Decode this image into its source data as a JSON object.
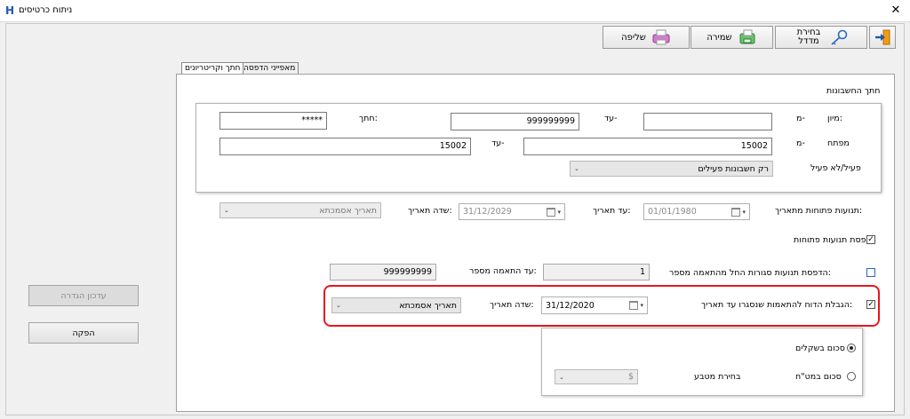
{
  "window": {
    "title": "ניתוח כרטיסים",
    "close": "✕",
    "app_icon": "H"
  },
  "toolbar": {
    "exit_icon": "exit-door-icon",
    "choose_index_label": "בחירת מדדל",
    "save_label": "שמירה",
    "send_label": "שליפה"
  },
  "tabs": [
    {
      "label": "חתך וקריטריונים"
    },
    {
      "label": "מאפייני הדפסה"
    }
  ],
  "account_section": {
    "title": "חתך החשבונות",
    "sort": {
      "label": "מיון:",
      "from_label": "מ-",
      "from_value": "",
      "to_label": "עד-",
      "to_value": "999999999",
      "cut_label": "חתך:",
      "cut_value": "*****"
    },
    "key": {
      "label": "מפתח",
      "from_label": "מ-",
      "from_value": "15002",
      "to_label": "עד-",
      "to_value": "15002"
    },
    "active": {
      "label": "פעיל/לא פעיל",
      "value": "רק חשבונות פעילים"
    }
  },
  "open_movements": {
    "label": "תנועות פתוחות מתאריך:",
    "from_date": "01/01/1980",
    "to_label": "עד תאריך:",
    "to_date": "31/12/2029",
    "date_field_label": "שדה תאריך:",
    "date_field_value": "תאריך אסמכתא"
  },
  "print_open_movements": {
    "label": "הדפסת תנועות פתוחות",
    "checked": "✓"
  },
  "closed_matches": {
    "label": "הדפסת תנועות סגורות החל מהתאמה מספר:",
    "from_value": "1",
    "to_label": "עד התאמה מספר:",
    "to_value": "999999999"
  },
  "limit_report": {
    "label": "הגבלת הדוח להתאמות שנסגרו עד תאריך:",
    "checked": "✓",
    "date": "31/12/2020",
    "date_field_label": "שדה תאריך:",
    "date_field_value": "תאריך אסמכתא"
  },
  "summary": {
    "shekels_label": "סכום בשקלים",
    "foreign_label": "סכום במט\"ח",
    "currency_label": "בחירת מטבע",
    "currency_value": "$"
  },
  "side_buttons": {
    "update_setting": "עדכון הגדרה",
    "run": "הפקה"
  },
  "colors": {
    "highlight": "#e8151d",
    "accent": "#1e5aa8"
  }
}
